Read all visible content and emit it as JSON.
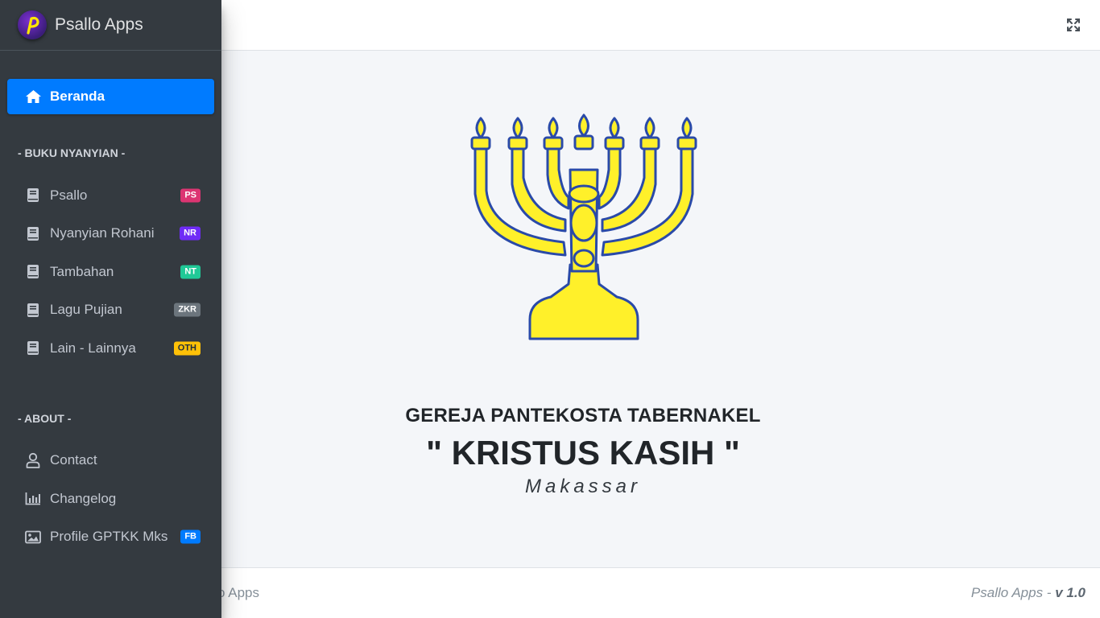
{
  "brand": {
    "name": "Psallo Apps",
    "logo_letter": "P"
  },
  "sidebar": {
    "home": {
      "label": "Beranda",
      "icon": "home-icon"
    },
    "songbooks_header": "- BUKU NYANYIAN -",
    "songbooks": [
      {
        "label": "Psallo",
        "badge": "PS",
        "badge_color": "#dc3572",
        "icon": "book-icon"
      },
      {
        "label": "Nyanyian Rohani",
        "badge": "NR",
        "badge_color": "#6f2bf6",
        "icon": "book-icon"
      },
      {
        "label": "Tambahan",
        "badge": "NT",
        "badge_color": "#20c997",
        "icon": "book-icon"
      },
      {
        "label": "Lagu Pujian",
        "badge": "ZKR",
        "badge_color": "#6c757d",
        "icon": "book-icon"
      },
      {
        "label": "Lain - Lainnya",
        "badge": "OTH",
        "badge_color": "#ffc107",
        "icon": "book-icon"
      }
    ],
    "about_header": "- ABOUT -",
    "about": [
      {
        "label": "Contact",
        "icon": "user-icon"
      },
      {
        "label": "Changelog",
        "icon": "chart-bar-icon"
      },
      {
        "label": "Profile GPTKK Mks",
        "badge": "FB",
        "badge_color": "#007bff",
        "icon": "image-icon"
      }
    ]
  },
  "navbar": {
    "fullscreen_icon": "expand-icon"
  },
  "main": {
    "church_name": "GEREJA PANTEKOSTA TABERNAKEL",
    "church_title": "\" KRISTUS KASIH \"",
    "church_city": "Makassar"
  },
  "footer": {
    "left_text": "allo Apps",
    "right_app": "Psallo Apps -",
    "right_version": "v 1.0"
  },
  "colors": {
    "sidebar_bg": "#343a40",
    "primary": "#007bff",
    "menorah_fill": "#fff02a",
    "menorah_outline": "#2a4aa8"
  }
}
